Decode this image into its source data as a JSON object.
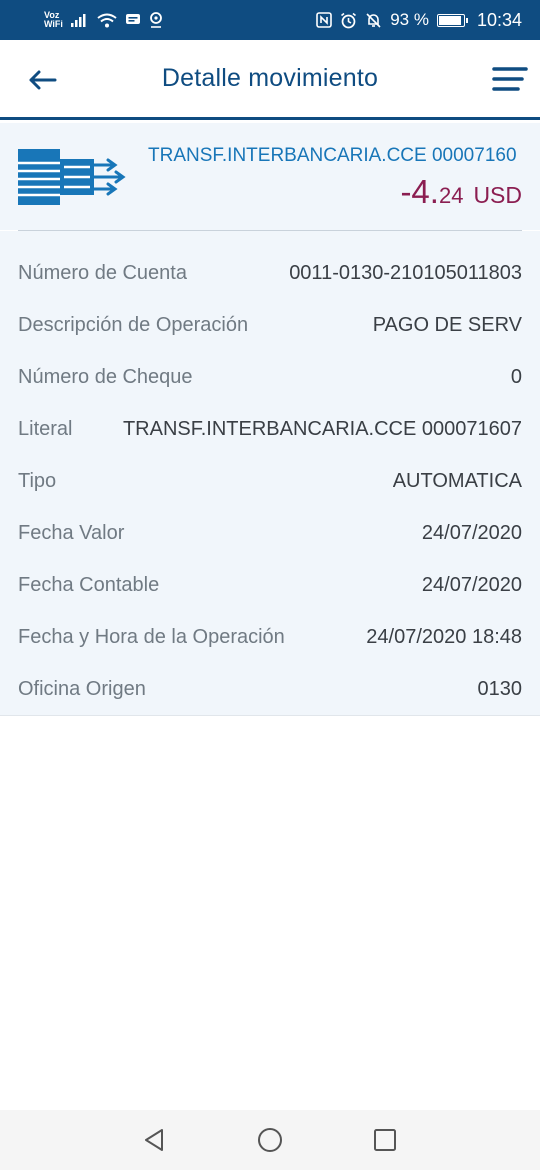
{
  "status_bar": {
    "voz": "Voz",
    "wifi": "WiFi",
    "battery_percent": "93 %",
    "battery_level": 0.93,
    "time": "10:34",
    "icons": [
      "signal-icon",
      "wifi-icon",
      "message-icon",
      "location-icon",
      "nfc-icon",
      "alarm-icon",
      "mute-icon",
      "battery-icon"
    ]
  },
  "header": {
    "title": "Detalle movimiento",
    "back_icon": "arrow-left-icon",
    "menu_icon": "menu-icon"
  },
  "summary": {
    "icon": "transfer-icon",
    "description": "TRANSF.INTERBANCARIA.CCE 00007160",
    "amount_int": "-4.",
    "amount_dec": "24",
    "currency": "USD"
  },
  "details": [
    {
      "label": "Número de Cuenta",
      "value": "0011-0130-210105011803"
    },
    {
      "label": "Descripción de Operación",
      "value": "PAGO DE SERV"
    },
    {
      "label": "Número de Cheque",
      "value": "0"
    },
    {
      "label": "Literal",
      "value": "TRANSF.INTERBANCARIA.CCE 000071607"
    },
    {
      "label": "Tipo",
      "value": "AUTOMATICA"
    },
    {
      "label": "Fecha Valor",
      "value": "24/07/2020"
    },
    {
      "label": "Fecha Contable",
      "value": "24/07/2020"
    },
    {
      "label": "Fecha y Hora de la Operación",
      "value": "24/07/2020 18:48"
    },
    {
      "label": "Oficina Origen",
      "value": "0130"
    }
  ],
  "navbar": {
    "icons": [
      "back-triangle-icon",
      "home-circle-icon",
      "recents-square-icon"
    ]
  },
  "colors": {
    "brand": "#0f4c81",
    "link": "#1876b8",
    "amount": "#8b1e51",
    "panel": "#f1f6fb"
  }
}
